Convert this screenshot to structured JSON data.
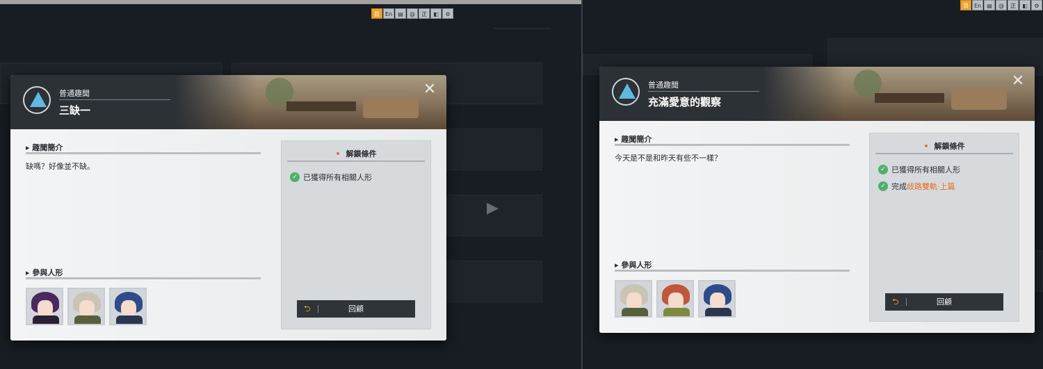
{
  "toolbar": {
    "buttons": [
      {
        "label": "目",
        "active": true
      },
      {
        "label": "En",
        "active": false
      },
      {
        "label": "▤",
        "active": false
      },
      {
        "label": "@",
        "active": false
      },
      {
        "label": "正",
        "active": false
      },
      {
        "label": "◧",
        "active": false
      },
      {
        "label": "⚙",
        "active": false
      }
    ]
  },
  "left_dialog": {
    "category": "普通趣聞",
    "title": "三缺一",
    "intro_heading": "趣聞簡介",
    "intro_text": "缺嗎？好像並不缺。",
    "participants_heading": "參與人形",
    "unlock_heading": "解鎖條件",
    "conditions": [
      "已獲得所有相關人形"
    ],
    "review_label": "回顧",
    "avatars": [
      "avatar-purple-hair-icon",
      "avatar-green-cap-icon",
      "avatar-blue-hair-icon"
    ]
  },
  "right_dialog": {
    "category": "普通趣聞",
    "title": "充滿愛意的觀察",
    "intro_heading": "趣聞簡介",
    "intro_text": "今天是不是和昨天有些不一樣？",
    "participants_heading": "參與人形",
    "unlock_heading": "解鎖條件",
    "conditions": [
      "已獲得所有相關人形"
    ],
    "condition2_prefix": "完成",
    "condition2_link": "歧路雙軌·上篇",
    "review_label": "回顧",
    "avatars": [
      "avatar-green-cap-icon",
      "avatar-red-hair-icon",
      "avatar-blue-hair-icon"
    ]
  },
  "colors": {
    "accent": "#f0a22a",
    "highlight": "#e86a20",
    "check": "#4fb06a"
  }
}
